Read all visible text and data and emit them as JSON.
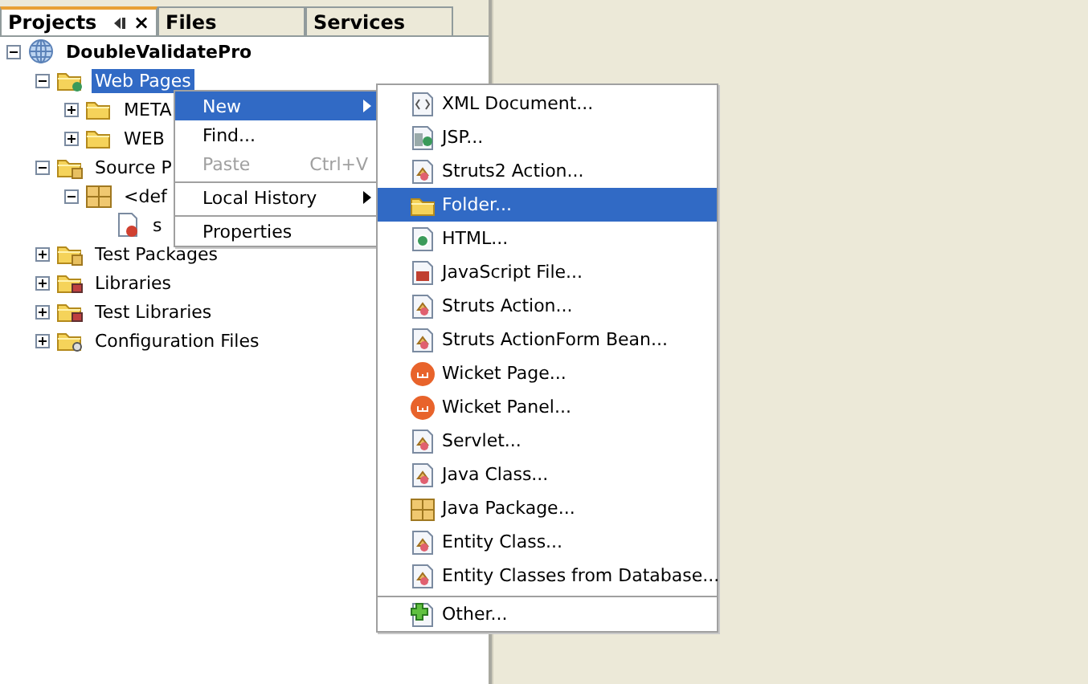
{
  "tabs": [
    {
      "label": "Projects",
      "selected": true,
      "close": "×"
    },
    {
      "label": "Files",
      "selected": false
    },
    {
      "label": "Services",
      "selected": false
    }
  ],
  "tree": [
    {
      "label": "DoubleValidatePro",
      "kind": "project",
      "expanded": true,
      "selected": false,
      "children": [
        {
          "label": "Web Pages",
          "kind": "webfolder",
          "expanded": true,
          "selected": true,
          "children": [
            {
              "label": "META",
              "kind": "folder",
              "expanded": false,
              "selected": false
            },
            {
              "label": "WEB",
              "kind": "folder",
              "expanded": false,
              "selected": false
            }
          ]
        },
        {
          "label": "Source P",
          "kind": "source",
          "expanded": true,
          "selected": false,
          "children": [
            {
              "label": "<def",
              "kind": "package",
              "expanded": true,
              "selected": false,
              "children": [
                {
                  "label": "s",
                  "kind": "file",
                  "selected": false
                }
              ]
            }
          ]
        },
        {
          "label": "Test Packages",
          "kind": "source",
          "expanded": false,
          "selected": false
        },
        {
          "label": "Libraries",
          "kind": "library",
          "expanded": false,
          "selected": false
        },
        {
          "label": "Test Libraries",
          "kind": "library",
          "expanded": false,
          "selected": false
        },
        {
          "label": "Configuration Files",
          "kind": "config",
          "expanded": false,
          "selected": false
        }
      ]
    }
  ],
  "context_menu": [
    {
      "label": "New",
      "selected": true,
      "disabled": false,
      "submenu": true,
      "separator_before": false
    },
    {
      "label": "Find...",
      "selected": false,
      "disabled": false,
      "submenu": false,
      "separator_before": false
    },
    {
      "label": "Paste",
      "shortcut": "Ctrl+V",
      "selected": false,
      "disabled": true,
      "submenu": false,
      "separator_before": false
    },
    {
      "label": "Local History",
      "selected": false,
      "disabled": false,
      "submenu": true,
      "separator_before": true
    },
    {
      "label": "Properties",
      "selected": false,
      "disabled": false,
      "submenu": false,
      "separator_before": true
    }
  ],
  "submenu": [
    {
      "label": "XML Document...",
      "kind": "xml",
      "selected": false,
      "separator_before": false
    },
    {
      "label": "JSP...",
      "kind": "jsp",
      "selected": false,
      "separator_before": false
    },
    {
      "label": "Struts2 Action...",
      "kind": "class",
      "selected": false,
      "separator_before": false
    },
    {
      "label": "Folder...",
      "kind": "folder",
      "selected": true,
      "separator_before": false
    },
    {
      "label": "HTML...",
      "kind": "html",
      "selected": false,
      "separator_before": false
    },
    {
      "label": "JavaScript File...",
      "kind": "js",
      "selected": false,
      "separator_before": false
    },
    {
      "label": "Struts Action...",
      "kind": "class",
      "selected": false,
      "separator_before": false
    },
    {
      "label": "Struts ActionForm Bean...",
      "kind": "class",
      "selected": false,
      "separator_before": false
    },
    {
      "label": "Wicket Page...",
      "kind": "wicket",
      "selected": false,
      "separator_before": false
    },
    {
      "label": "Wicket Panel...",
      "kind": "wicket",
      "selected": false,
      "separator_before": false
    },
    {
      "label": "Servlet...",
      "kind": "class",
      "selected": false,
      "separator_before": false
    },
    {
      "label": "Java Class...",
      "kind": "class",
      "selected": false,
      "separator_before": false
    },
    {
      "label": "Java Package...",
      "kind": "package",
      "selected": false,
      "separator_before": false
    },
    {
      "label": "Entity Class...",
      "kind": "class",
      "selected": false,
      "separator_before": false
    },
    {
      "label": "Entity Classes from Database...",
      "kind": "class",
      "selected": false,
      "separator_before": false
    },
    {
      "label": "Other...",
      "kind": "other",
      "selected": false,
      "separator_before": true
    }
  ]
}
